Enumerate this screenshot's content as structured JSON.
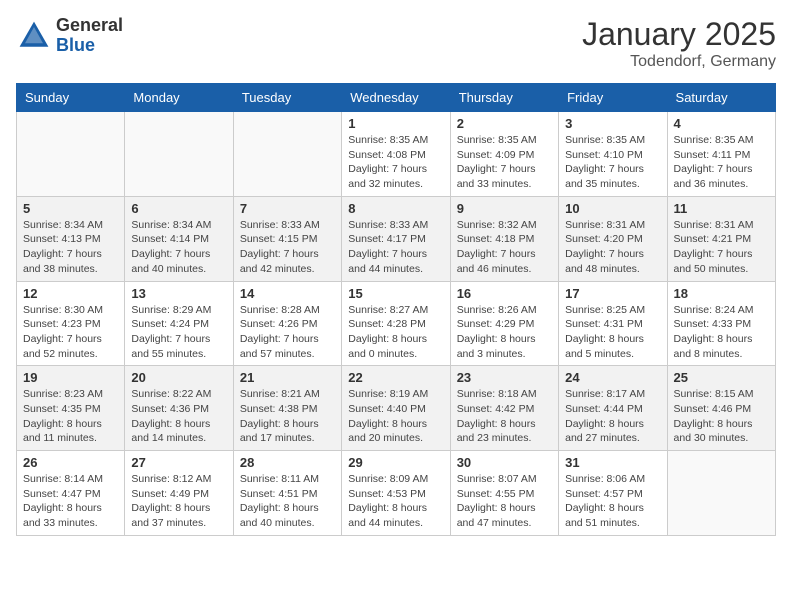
{
  "header": {
    "logo_general": "General",
    "logo_blue": "Blue",
    "month_title": "January 2025",
    "location": "Todendorf, Germany"
  },
  "weekdays": [
    "Sunday",
    "Monday",
    "Tuesday",
    "Wednesday",
    "Thursday",
    "Friday",
    "Saturday"
  ],
  "weeks": [
    [
      {
        "day": "",
        "info": ""
      },
      {
        "day": "",
        "info": ""
      },
      {
        "day": "",
        "info": ""
      },
      {
        "day": "1",
        "info": "Sunrise: 8:35 AM\nSunset: 4:08 PM\nDaylight: 7 hours\nand 32 minutes."
      },
      {
        "day": "2",
        "info": "Sunrise: 8:35 AM\nSunset: 4:09 PM\nDaylight: 7 hours\nand 33 minutes."
      },
      {
        "day": "3",
        "info": "Sunrise: 8:35 AM\nSunset: 4:10 PM\nDaylight: 7 hours\nand 35 minutes."
      },
      {
        "day": "4",
        "info": "Sunrise: 8:35 AM\nSunset: 4:11 PM\nDaylight: 7 hours\nand 36 minutes."
      }
    ],
    [
      {
        "day": "5",
        "info": "Sunrise: 8:34 AM\nSunset: 4:13 PM\nDaylight: 7 hours\nand 38 minutes."
      },
      {
        "day": "6",
        "info": "Sunrise: 8:34 AM\nSunset: 4:14 PM\nDaylight: 7 hours\nand 40 minutes."
      },
      {
        "day": "7",
        "info": "Sunrise: 8:33 AM\nSunset: 4:15 PM\nDaylight: 7 hours\nand 42 minutes."
      },
      {
        "day": "8",
        "info": "Sunrise: 8:33 AM\nSunset: 4:17 PM\nDaylight: 7 hours\nand 44 minutes."
      },
      {
        "day": "9",
        "info": "Sunrise: 8:32 AM\nSunset: 4:18 PM\nDaylight: 7 hours\nand 46 minutes."
      },
      {
        "day": "10",
        "info": "Sunrise: 8:31 AM\nSunset: 4:20 PM\nDaylight: 7 hours\nand 48 minutes."
      },
      {
        "day": "11",
        "info": "Sunrise: 8:31 AM\nSunset: 4:21 PM\nDaylight: 7 hours\nand 50 minutes."
      }
    ],
    [
      {
        "day": "12",
        "info": "Sunrise: 8:30 AM\nSunset: 4:23 PM\nDaylight: 7 hours\nand 52 minutes."
      },
      {
        "day": "13",
        "info": "Sunrise: 8:29 AM\nSunset: 4:24 PM\nDaylight: 7 hours\nand 55 minutes."
      },
      {
        "day": "14",
        "info": "Sunrise: 8:28 AM\nSunset: 4:26 PM\nDaylight: 7 hours\nand 57 minutes."
      },
      {
        "day": "15",
        "info": "Sunrise: 8:27 AM\nSunset: 4:28 PM\nDaylight: 8 hours\nand 0 minutes."
      },
      {
        "day": "16",
        "info": "Sunrise: 8:26 AM\nSunset: 4:29 PM\nDaylight: 8 hours\nand 3 minutes."
      },
      {
        "day": "17",
        "info": "Sunrise: 8:25 AM\nSunset: 4:31 PM\nDaylight: 8 hours\nand 5 minutes."
      },
      {
        "day": "18",
        "info": "Sunrise: 8:24 AM\nSunset: 4:33 PM\nDaylight: 8 hours\nand 8 minutes."
      }
    ],
    [
      {
        "day": "19",
        "info": "Sunrise: 8:23 AM\nSunset: 4:35 PM\nDaylight: 8 hours\nand 11 minutes."
      },
      {
        "day": "20",
        "info": "Sunrise: 8:22 AM\nSunset: 4:36 PM\nDaylight: 8 hours\nand 14 minutes."
      },
      {
        "day": "21",
        "info": "Sunrise: 8:21 AM\nSunset: 4:38 PM\nDaylight: 8 hours\nand 17 minutes."
      },
      {
        "day": "22",
        "info": "Sunrise: 8:19 AM\nSunset: 4:40 PM\nDaylight: 8 hours\nand 20 minutes."
      },
      {
        "day": "23",
        "info": "Sunrise: 8:18 AM\nSunset: 4:42 PM\nDaylight: 8 hours\nand 23 minutes."
      },
      {
        "day": "24",
        "info": "Sunrise: 8:17 AM\nSunset: 4:44 PM\nDaylight: 8 hours\nand 27 minutes."
      },
      {
        "day": "25",
        "info": "Sunrise: 8:15 AM\nSunset: 4:46 PM\nDaylight: 8 hours\nand 30 minutes."
      }
    ],
    [
      {
        "day": "26",
        "info": "Sunrise: 8:14 AM\nSunset: 4:47 PM\nDaylight: 8 hours\nand 33 minutes."
      },
      {
        "day": "27",
        "info": "Sunrise: 8:12 AM\nSunset: 4:49 PM\nDaylight: 8 hours\nand 37 minutes."
      },
      {
        "day": "28",
        "info": "Sunrise: 8:11 AM\nSunset: 4:51 PM\nDaylight: 8 hours\nand 40 minutes."
      },
      {
        "day": "29",
        "info": "Sunrise: 8:09 AM\nSunset: 4:53 PM\nDaylight: 8 hours\nand 44 minutes."
      },
      {
        "day": "30",
        "info": "Sunrise: 8:07 AM\nSunset: 4:55 PM\nDaylight: 8 hours\nand 47 minutes."
      },
      {
        "day": "31",
        "info": "Sunrise: 8:06 AM\nSunset: 4:57 PM\nDaylight: 8 hours\nand 51 minutes."
      },
      {
        "day": "",
        "info": ""
      }
    ]
  ]
}
